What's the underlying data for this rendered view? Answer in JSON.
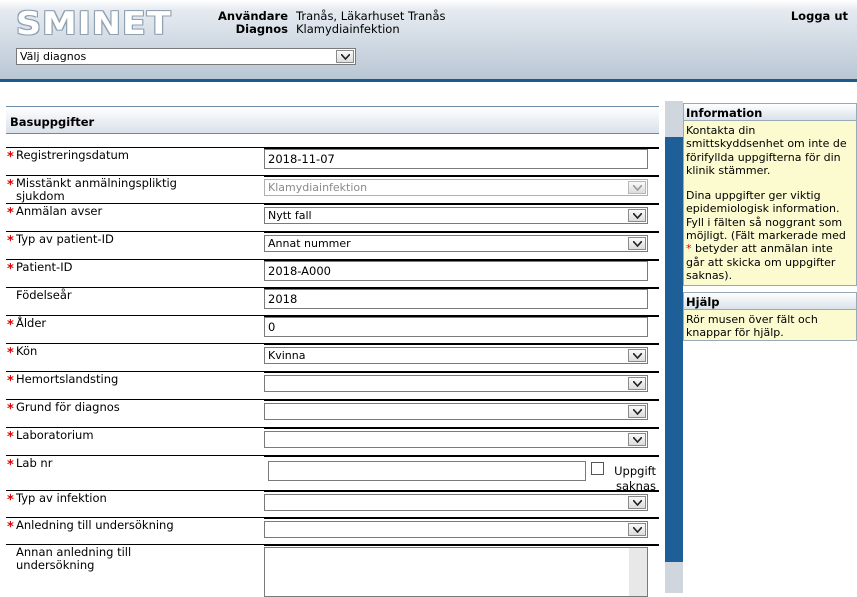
{
  "header": {
    "logo": "SMINET",
    "user_label": "Användare",
    "user_value": "Tranås, Läkarhuset Tranås",
    "diagnosis_label": "Diagnos",
    "diagnosis_value": "Klamydiainfektion",
    "logout": "Logga ut",
    "diagnosis_select": "Välj diagnos"
  },
  "form": {
    "title": "Basuppgifter",
    "required_marker": "*",
    "fields": {
      "registration_date": {
        "label": "Registreringsdatum",
        "value": "2018-11-07"
      },
      "suspected_disease": {
        "label": "Misstänkt anmälningspliktig sjukdom",
        "value": "Klamydiainfektion"
      },
      "report_concerns": {
        "label": "Anmälan avser",
        "value": "Nytt fall"
      },
      "patient_id_type": {
        "label": "Typ av patient-ID",
        "value": "Annat nummer"
      },
      "patient_id": {
        "label": "Patient-ID",
        "value": "2018-A000"
      },
      "birth_year": {
        "label": "Födelseår",
        "value": "2018"
      },
      "age": {
        "label": "Ålder",
        "value": "0"
      },
      "gender": {
        "label": "Kön",
        "value": "Kvinna"
      },
      "home_county": {
        "label": "Hemortslandsting",
        "value": ""
      },
      "diagnosis_basis": {
        "label": "Grund för diagnos",
        "value": ""
      },
      "laboratory": {
        "label": "Laboratorium",
        "value": ""
      },
      "lab_nr": {
        "label": "Lab nr",
        "value": "",
        "missing_label": "Uppgift saknas"
      },
      "infection_type": {
        "label": "Typ av infektion",
        "value": ""
      },
      "exam_reason": {
        "label": "Anledning till undersökning",
        "value": ""
      },
      "other_exam_reason": {
        "label": "Annan anledning till undersökning",
        "value": ""
      }
    }
  },
  "info_panel": {
    "title": "Information",
    "text1": "Kontakta din smittskyddsenhet om inte de förifyllda uppgifterna för din klinik stämmer.",
    "text2a": "Dina uppgifter ger viktig epidemiologisk information. Fyll i fälten så noggrant som möjligt. (Fält markerade med ",
    "text2_marker": "*",
    "text2b": " betyder att anmälan inte går att skicka om uppgifter saknas)."
  },
  "help_panel": {
    "title": "Hjälp",
    "text": "Rör musen över fält och knappar för hjälp."
  },
  "colors": {
    "accent_blue": "#1e5f97",
    "required_red": "#e00000",
    "info_background": "#fcfbd0"
  }
}
